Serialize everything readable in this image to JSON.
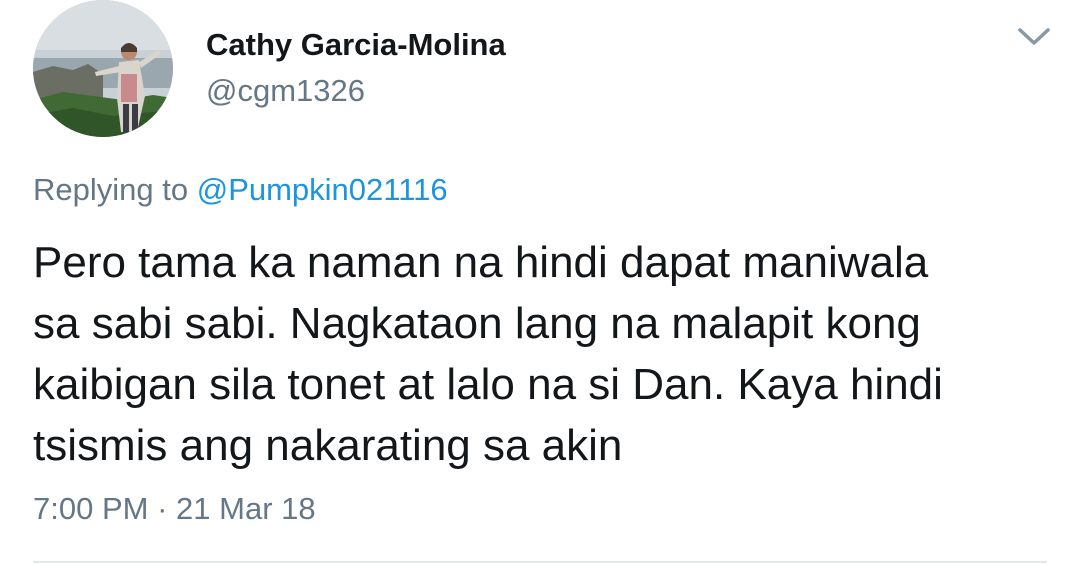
{
  "tweet": {
    "author_name": "Cathy Garcia-Molina",
    "author_handle": "@cgm1326",
    "replying_to_prefix": "Replying to",
    "replying_to_handle": "@Pumpkin021116",
    "text_lines": [
      "Pero tama ka naman na hindi dapat maniwala",
      "sa sabi sabi. Nagkataon lang na malapit kong",
      "kaibigan sila tonet at lalo na si Dan. Kaya hindi",
      "tsismis ang nakarating sa akin"
    ],
    "time": "7:00 PM",
    "separator": "·",
    "date": "21 Mar 18"
  },
  "icons": {
    "menu": "chevron-down-icon",
    "avatar": "profile-photo"
  },
  "colors": {
    "name": "#14171a",
    "secondary": "#657786",
    "link": "#1b95e0",
    "divider": "#e1e8ed",
    "background": "#ffffff"
  }
}
